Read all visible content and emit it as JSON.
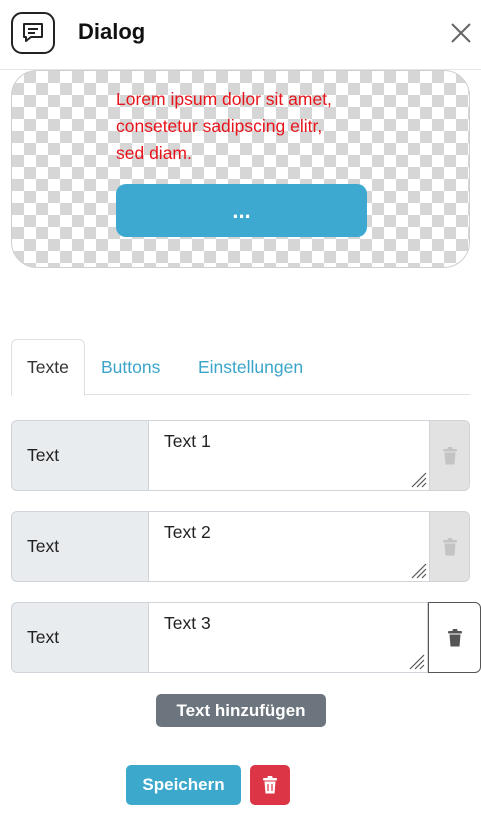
{
  "header": {
    "title": "Dialog",
    "icon": "chat-message-icon",
    "close_icon": "close-icon"
  },
  "preview": {
    "text": "Lorem ipsum dolor sit amet,\nconsetetur sadipscing elitr,\nsed diam.",
    "text_color": "#e8141b",
    "button_label": "...",
    "button_color": "#3ea9d0"
  },
  "tabs": [
    {
      "label": "Texte",
      "active": true
    },
    {
      "label": "Buttons",
      "active": false
    },
    {
      "label": "Einstellungen",
      "active": false
    }
  ],
  "rows": [
    {
      "label": "Text",
      "value": "Text 1",
      "delete_enabled": false
    },
    {
      "label": "Text",
      "value": "Text 2",
      "delete_enabled": false
    },
    {
      "label": "Text",
      "value": "Text 3",
      "delete_enabled": true
    }
  ],
  "actions": {
    "add_label": "Text hinzufügen",
    "save_label": "Speichern",
    "delete_icon": "trash-icon"
  },
  "colors": {
    "accent": "#3ba8cc",
    "danger": "#dc3545",
    "secondary": "#6c757d"
  }
}
